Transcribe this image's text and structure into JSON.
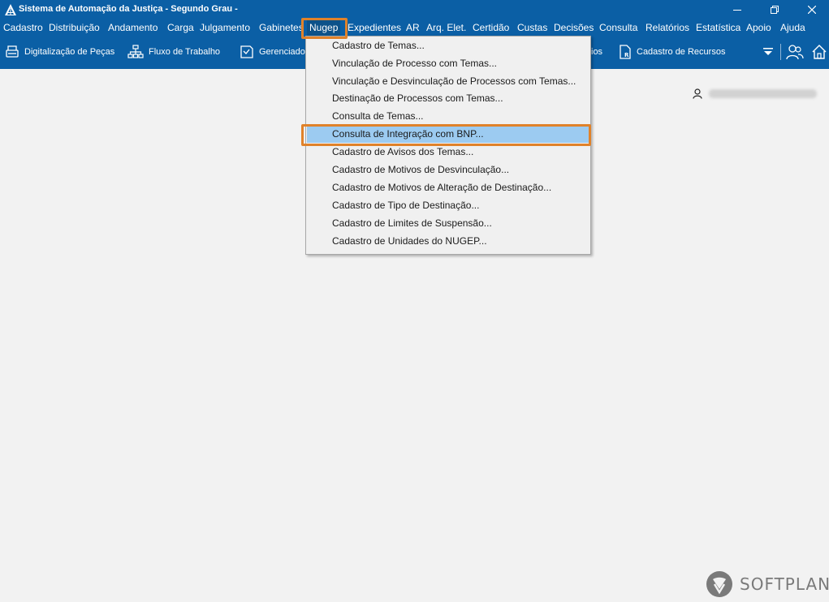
{
  "window": {
    "title": "Sistema de Automação da Justiça - Segundo Grau -"
  },
  "menubar": {
    "items": [
      "Cadastro",
      "Distribuição",
      "Andamento",
      "Carga",
      "Julgamento",
      "Gabinetes",
      "Nugep",
      "Expedientes",
      "AR",
      "Arq. Elet.",
      "Certidão",
      "Custas",
      "Decisões",
      "Consulta",
      "Relatórios",
      "Estatística",
      "Apoio",
      "Ajuda"
    ],
    "active": "Nugep"
  },
  "toolbar": {
    "digitalizacao": "Digitalização de Peças",
    "fluxo": "Fluxo de Trabalho",
    "gerenciador": "Gerenciado",
    "hidden_suffix": "ios",
    "cadastro_recursos": "Cadastro de Recursos"
  },
  "nugep_menu": {
    "items": [
      "Cadastro de Temas...",
      "Vinculação de Processo com Temas...",
      "Vinculação e Desvinculação de Processos com Temas...",
      "Destinação de Processos com Temas...",
      "Consulta de Temas...",
      "Consulta de Integração com BNP...",
      "Cadastro de Avisos dos Temas...",
      "Cadastro de Motivos de Desvinculação...",
      "Cadastro de Motivos de Alteração de Destinação...",
      "Cadastro de Tipo de Destinação...",
      "Cadastro de Limites de Suspensão...",
      "Cadastro de Unidades do NUGEP..."
    ],
    "selected": "Consulta de Integração com BNP..."
  },
  "branding": {
    "logo_text": "SOFTPLAN"
  },
  "colors": {
    "chrome": "#0b5fa5",
    "highlight": "#e0822a",
    "menu_selection": "#9ccbf1",
    "background": "#f2f2f2"
  }
}
